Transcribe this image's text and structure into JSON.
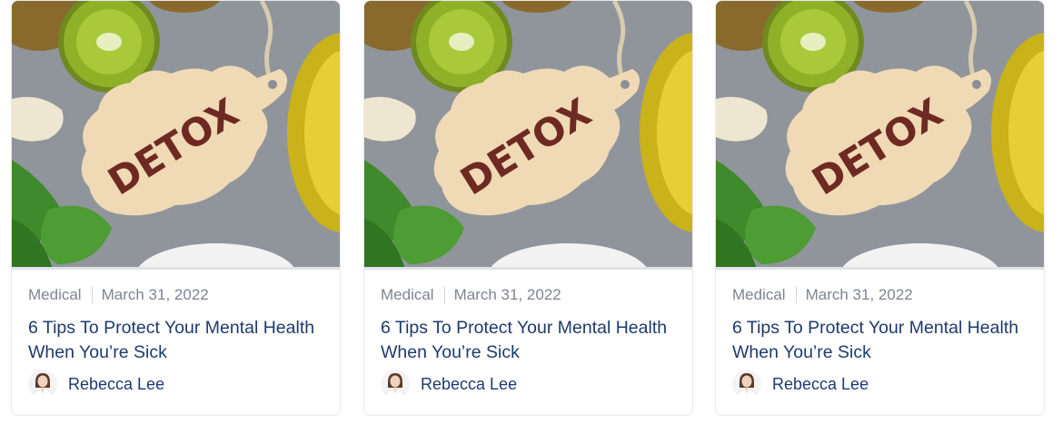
{
  "posts": [
    {
      "category": "Medical",
      "date": "March 31, 2022",
      "title": "6 Tips To Protect Your Mental Health When You’re Sick",
      "author": "Rebecca Lee",
      "image_label": "DETOX"
    },
    {
      "category": "Medical",
      "date": "March 31, 2022",
      "title": "6 Tips To Protect Your Mental Health When You’re Sick",
      "author": "Rebecca Lee",
      "image_label": "DETOX"
    },
    {
      "category": "Medical",
      "date": "March 31, 2022",
      "title": "6 Tips To Protect Your Mental Health When You’re Sick",
      "author": "Rebecca Lee",
      "image_label": "DETOX"
    }
  ],
  "colors": {
    "title": "#1e3a6e",
    "meta": "#7d8593",
    "border": "#e6e9ee",
    "detox_text": "#6e2a22"
  }
}
